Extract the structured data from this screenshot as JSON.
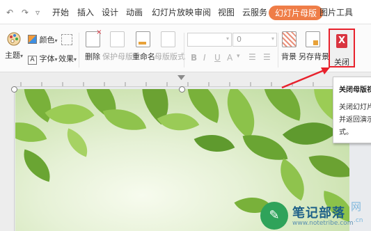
{
  "quick_access": {
    "undo": "↶",
    "redo": "↷",
    "more": "▿"
  },
  "tabs": [
    "开始",
    "插入",
    "设计",
    "动画",
    "幻灯片放映",
    "审阅",
    "视图",
    "云服务",
    "幻灯片母版",
    "图片工具"
  ],
  "ribbon": {
    "theme": "主题",
    "colors": "颜色",
    "fonts": "字体",
    "effects": "效果",
    "delete": "删除",
    "protect_master": "保护母版",
    "rename": "重命名",
    "master_layout": "母版版式",
    "font_size_value": "0",
    "bold": "B",
    "italic": "I",
    "underline": "U",
    "background": "背景",
    "save_background": "另存背景",
    "close": "关闭",
    "close_glyph": "X"
  },
  "tooltip": {
    "title": "关闭母版视",
    "lines": [
      "关闭幻灯片",
      "并返回演示",
      "式。"
    ]
  },
  "watermark": {
    "name": "笔记部落",
    "url": "www.notetribe.com",
    "cn_suffix": "网",
    "cn_domain": ".cn"
  },
  "colors": {
    "active_tab": "#ef7d47",
    "highlight_border": "#e8212c",
    "arrow": "#e8212c",
    "close_icon": "#d9343f"
  }
}
